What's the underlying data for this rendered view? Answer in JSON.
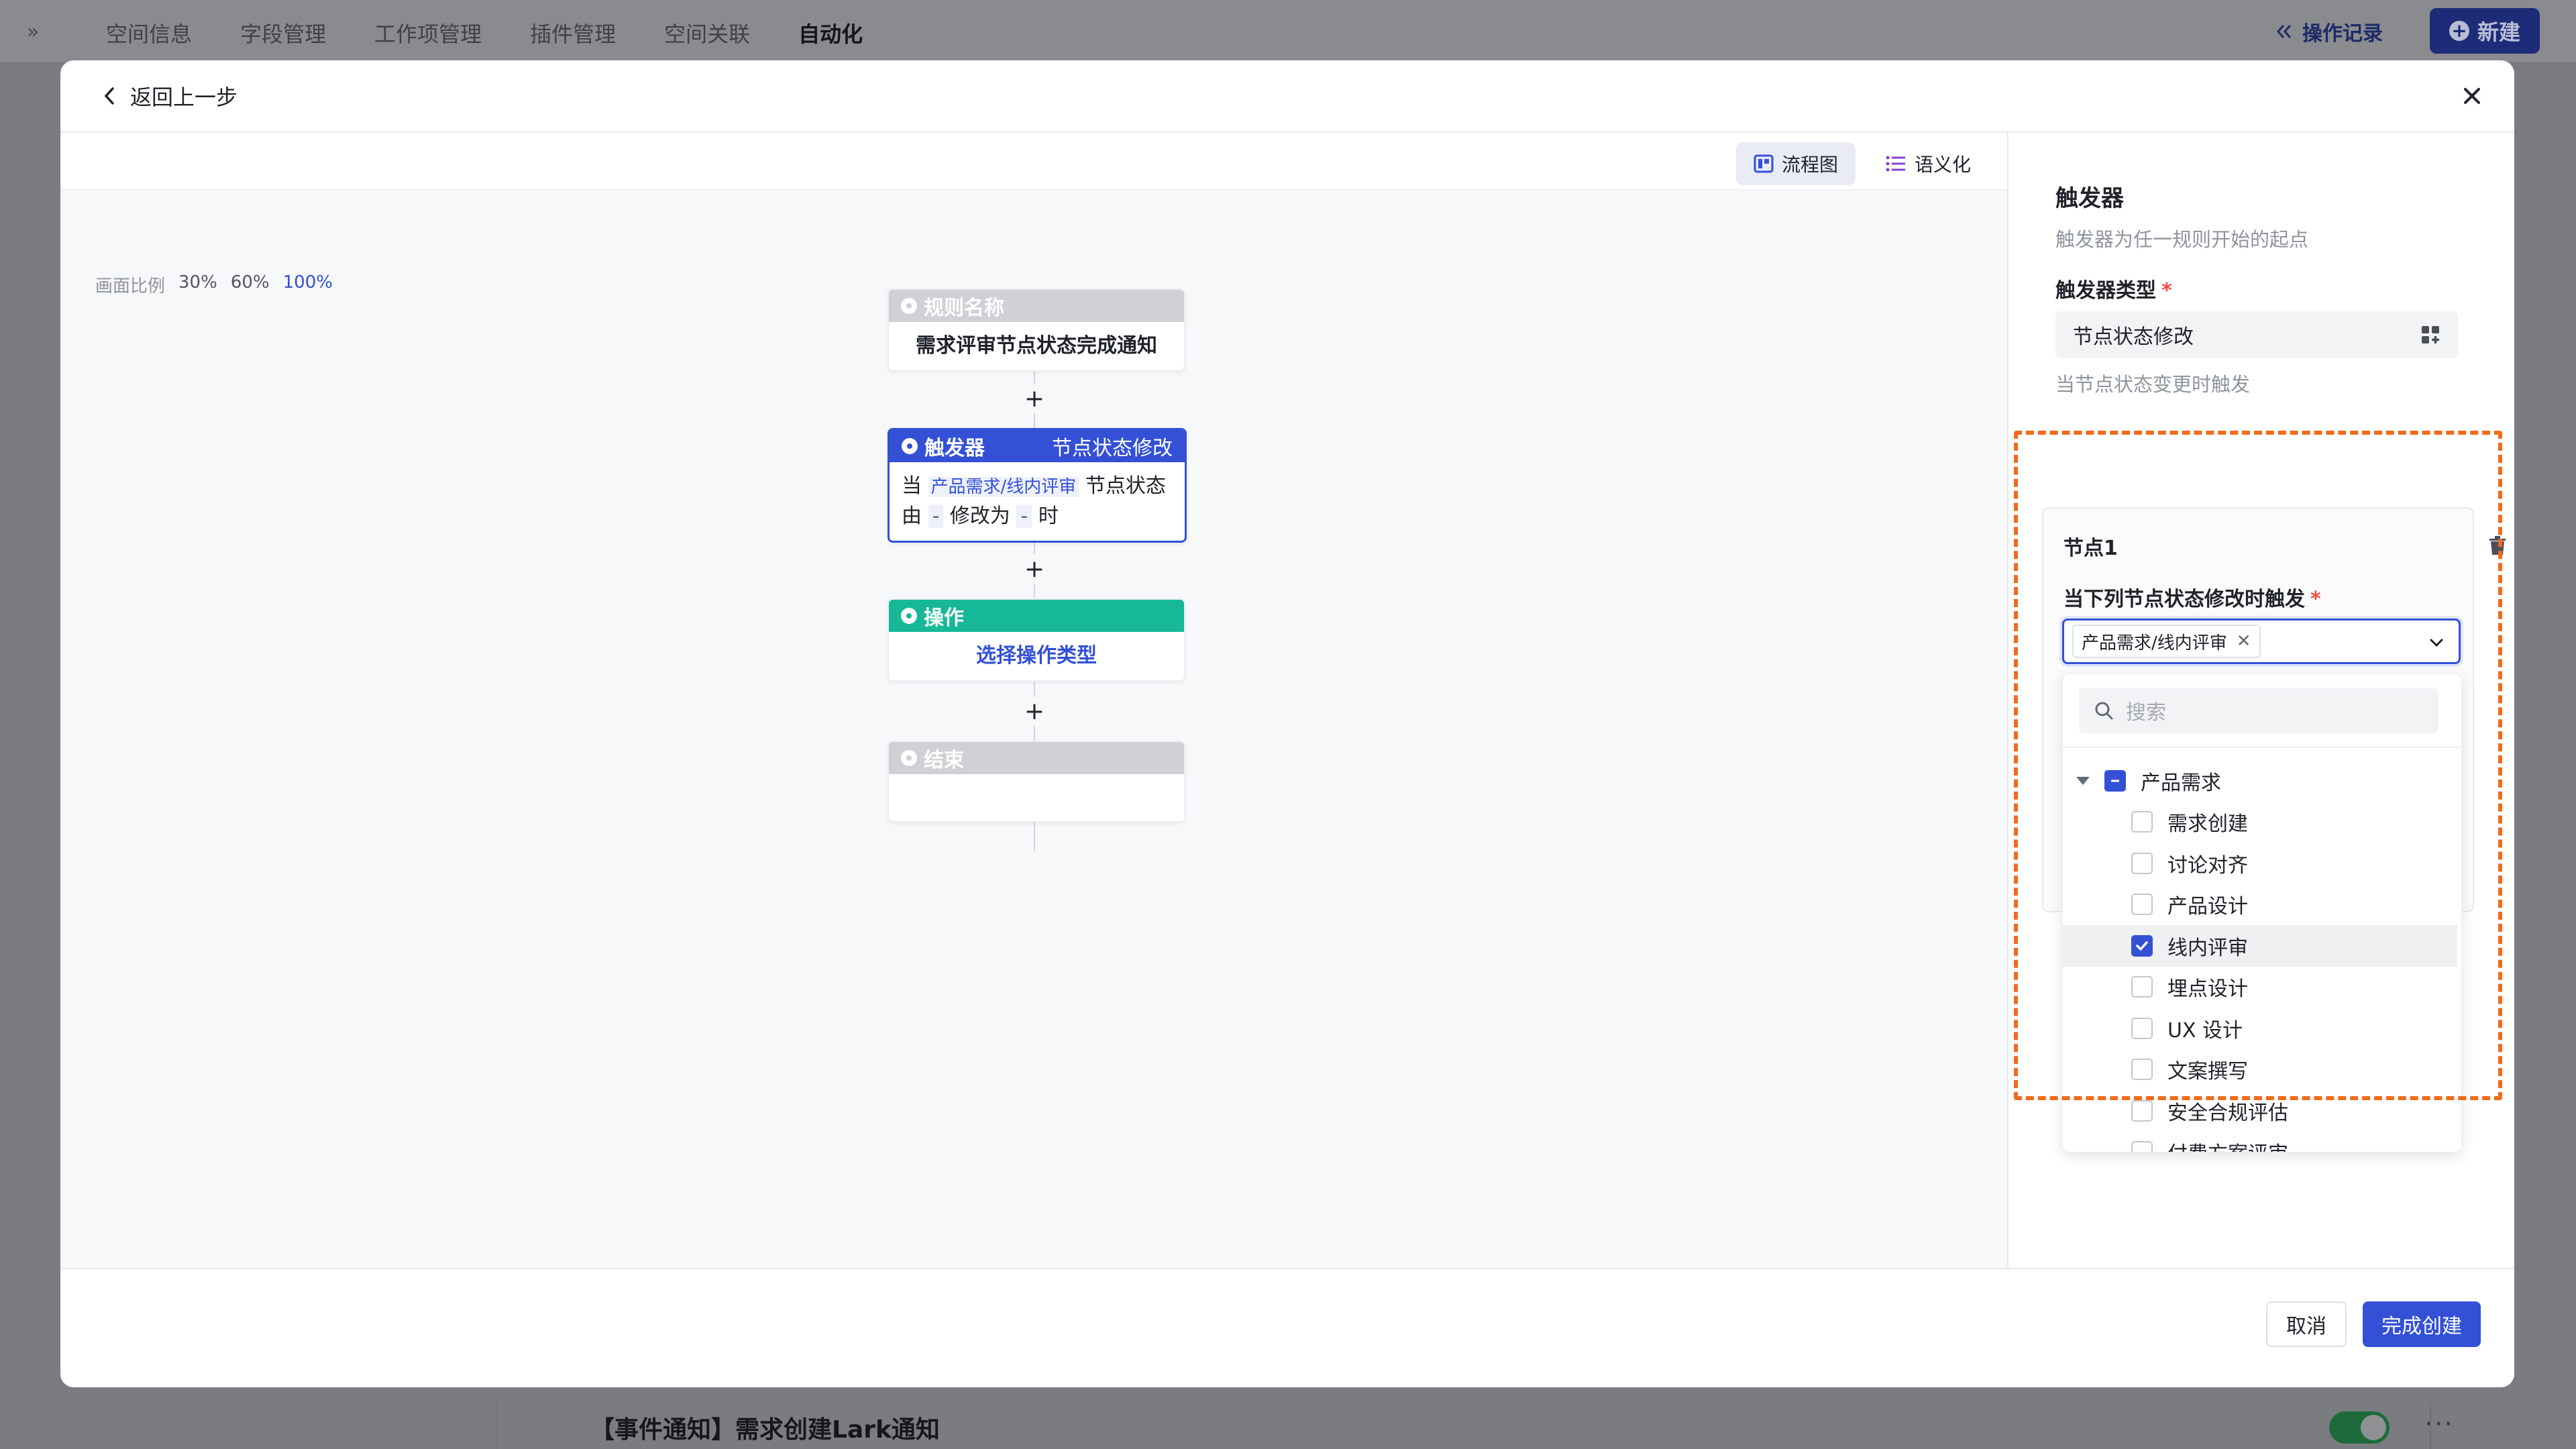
{
  "background": {
    "tabs": [
      "空间信息",
      "字段管理",
      "工作项管理",
      "插件管理",
      "空间关联",
      "自动化"
    ],
    "active_tab": "自动化",
    "operation_log": "操作记录",
    "new_button": "新建",
    "row_title": "【事件通知】需求创建Lark通知"
  },
  "modal": {
    "back_label": "返回上一步",
    "view_switch": {
      "flowchart": "流程图",
      "semantic": "语义化"
    },
    "zoom": {
      "label": "画面比例",
      "options": [
        "30%",
        "60%",
        "100%"
      ],
      "active": "100%"
    },
    "flow": {
      "rule_name": {
        "header": "规则名称",
        "body": "需求评审节点状态完成通知"
      },
      "trigger": {
        "header": "触发器",
        "type": "节点状态修改",
        "text_when": "当",
        "node_tag": "产品需求/线内评审",
        "text_node_state": "节点状态",
        "text_from": "由",
        "dash1": "-",
        "text_change_to": "修改为",
        "dash2": "-",
        "text_at": "时"
      },
      "action": {
        "header": "操作",
        "body": "选择操作类型"
      },
      "end": {
        "header": "结束"
      }
    },
    "panel": {
      "title": "触发器",
      "desc": "触发器为任一规则开始的起点",
      "type_label": "触发器类型",
      "type_value": "节点状态修改",
      "type_hint": "当节点状态变更时触发",
      "node_card": {
        "title": "节点1",
        "condition_label": "当下列节点状态修改时触发",
        "chip": "产品需求/线内评审",
        "search_placeholder": "搜索",
        "parent": "产品需求",
        "children": [
          {
            "label": "需求创建",
            "checked": false
          },
          {
            "label": "讨论对齐",
            "checked": false
          },
          {
            "label": "产品设计",
            "checked": false
          },
          {
            "label": "线内评审",
            "checked": true
          },
          {
            "label": "埋点设计",
            "checked": false
          },
          {
            "label": "UX 设计",
            "checked": false
          },
          {
            "label": "文案撰写",
            "checked": false
          },
          {
            "label": "安全合规评估",
            "checked": false
          },
          {
            "label": "付费方案评审",
            "checked": false
          }
        ]
      }
    },
    "footer": {
      "cancel": "取消",
      "confirm": "完成创建"
    }
  },
  "colors": {
    "primary": "#3350d6",
    "trigger_green": "#17b897",
    "highlight_orange": "#f06b1c",
    "danger": "#f54a45"
  }
}
